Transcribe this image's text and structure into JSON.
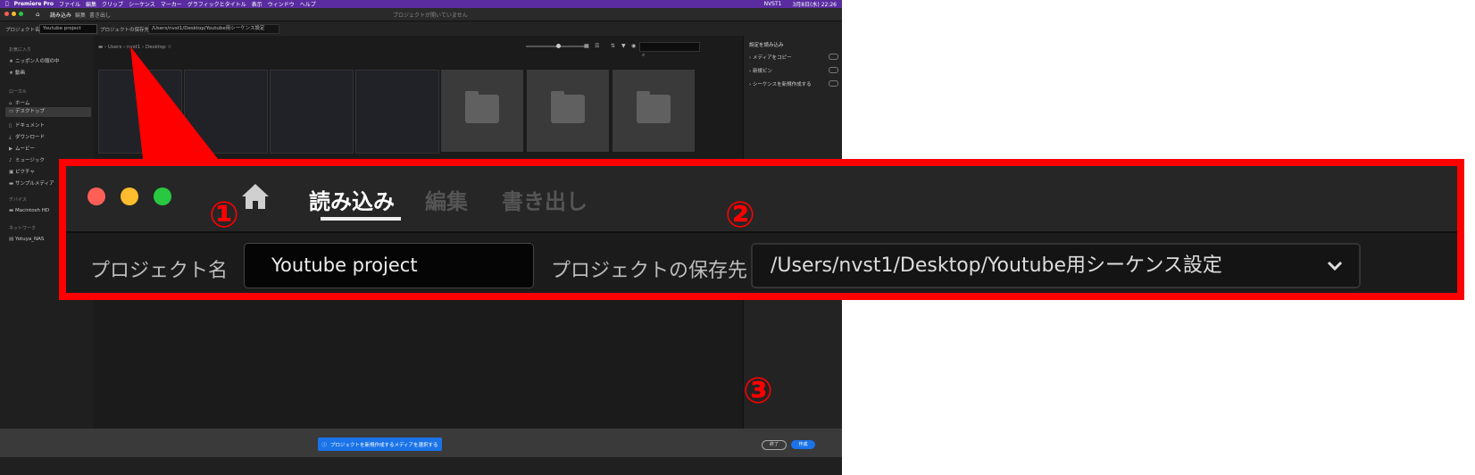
{
  "menubar": {
    "app_name": "Premiere Pro",
    "items": [
      "ファイル",
      "編集",
      "クリップ",
      "シーケンス",
      "マーカー",
      "グラフィックとタイトル",
      "表示",
      "ウィンドウ",
      "ヘルプ"
    ],
    "user": "NVST1",
    "clock": "3月8日(水) 22:26"
  },
  "tabs": {
    "import": "読み込み",
    "edit": "編集",
    "export": "書き出し"
  },
  "titlebar": {
    "status": "プロジェクトが開いていません"
  },
  "project": {
    "name_label": "プロジェクト名",
    "name_value": "Youtube project",
    "location_label": "プロジェクトの保存先",
    "location_value": "/Users/nvst1/Desktop/Youtube用シーケンス設定",
    "location_value_small": "/Users/nvst1/Desktop/Youtube用シーケンス設定"
  },
  "sidebar": {
    "favorites_header": "お気に入り",
    "favorites": [
      "ニッポン人の頭の中",
      "動画"
    ],
    "local_header": "ローカル",
    "local": [
      "ホーム",
      "デスクトップ",
      "ドキュメント",
      "ダウンロード",
      "ムービー",
      "ミュージック",
      "ピクチャ",
      "サンプルメディア"
    ],
    "devices_header": "デバイス",
    "devices": [
      "Macintosh HD"
    ],
    "network_header": "ネットワーク",
    "network": [
      "Yotuya_NAS"
    ]
  },
  "breadcrumb": {
    "users": "Users",
    "user": "nvst1",
    "desktop": "Desktop"
  },
  "right_panel": {
    "header": "設定を読み込み",
    "copy_media": "メディアをコピー",
    "new_bin": "新規ビン",
    "create_sequence": "シーケンスを新規作成する"
  },
  "bottom": {
    "info": "プロジェクトを新規作成するメディアを選択する",
    "close": "終了",
    "create": "作成"
  },
  "annotations": {
    "one": "①",
    "two": "②",
    "three": "③"
  },
  "colors": {
    "accent": "#1a73e8",
    "annotation": "#ff0000",
    "menubar": "#5a2ca0"
  }
}
